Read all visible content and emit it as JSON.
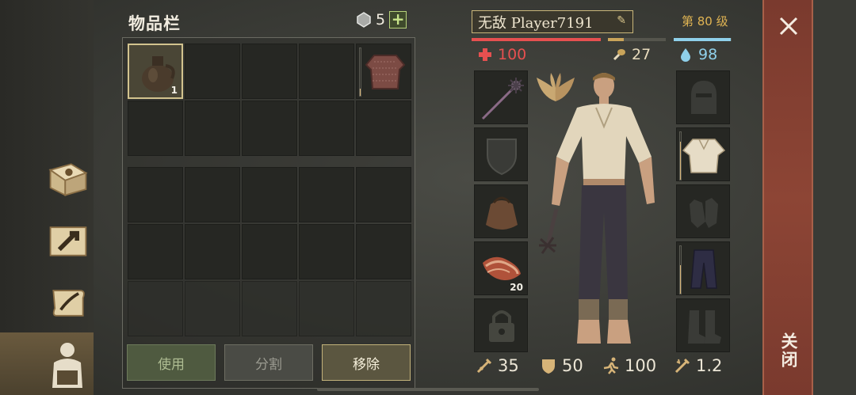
{
  "inventory": {
    "title": "物品栏",
    "gem_count": "5",
    "add_label": "+",
    "slots_row1": [
      {
        "icon": "clay-jug-icon",
        "qty": "1",
        "selected": true
      },
      {
        "icon": "",
        "qty": ""
      },
      {
        "icon": "",
        "qty": ""
      },
      {
        "icon": "",
        "qty": ""
      },
      {
        "icon": "chainmail-shirt-icon",
        "qty": "",
        "durability": 0.15
      }
    ],
    "buttons": {
      "use": "使用",
      "split": "分割",
      "remove": "移除"
    }
  },
  "character": {
    "name": "无敌 Player7191",
    "level": "第 80 级",
    "hp": "100",
    "food": "27",
    "water": "98",
    "hp_fraction": 1.0,
    "food_fraction": 0.27,
    "water_fraction": 0.98,
    "slots_left": [
      {
        "icon": "spiked-mace-icon",
        "qty": ""
      },
      {
        "icon": "shield-silhouette-icon",
        "qty": ""
      },
      {
        "icon": "leather-pouch-icon",
        "qty": ""
      },
      {
        "icon": "bacon-icon",
        "qty": "20"
      },
      {
        "icon": "locked-slot-icon",
        "qty": ""
      }
    ],
    "slots_right": [
      {
        "icon": "helmet-silhouette-icon"
      },
      {
        "icon": "linen-shirt-icon",
        "durability": 0.8
      },
      {
        "icon": "gloves-silhouette-icon"
      },
      {
        "icon": "trousers-icon",
        "durability": 0.6
      },
      {
        "icon": "boots-silhouette-icon"
      }
    ],
    "stats": {
      "attack": "35",
      "defense": "50",
      "speed": "100",
      "crit": "1.2"
    }
  },
  "close": {
    "label": "关闭"
  },
  "colors": {
    "hp": "#e65050",
    "food": "#c9a45a",
    "water": "#8fd0ea",
    "accent": "#d2c38e"
  }
}
